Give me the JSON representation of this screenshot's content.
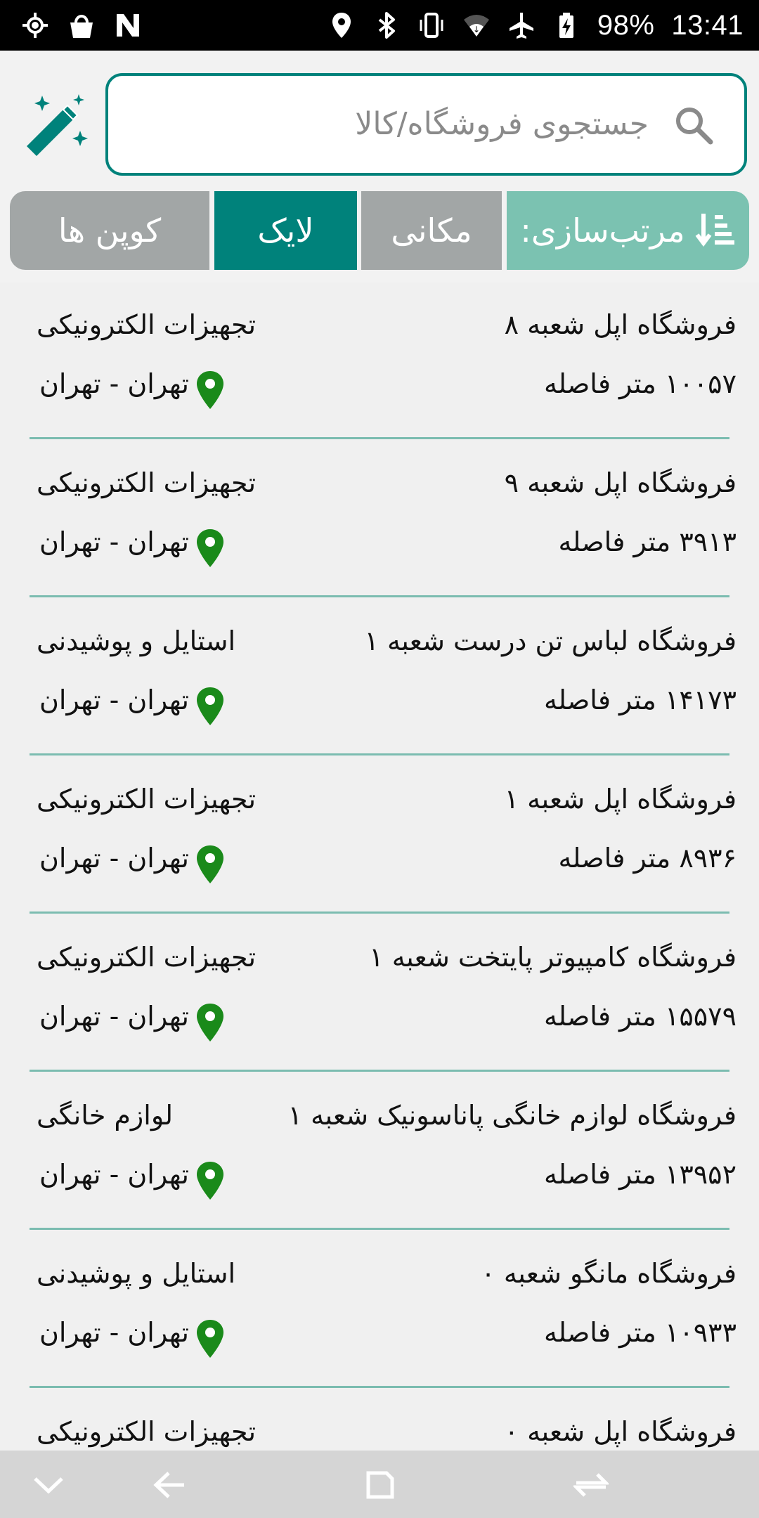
{
  "status_bar": {
    "battery": "98%",
    "time": "13:41",
    "icons": [
      "gps-icon",
      "shopping-bag-icon",
      "n-logo-icon",
      "location-icon",
      "bluetooth-icon",
      "vibrate-icon",
      "wifi-icon",
      "airplane-mode-icon",
      "battery-charging-icon"
    ]
  },
  "search": {
    "placeholder": "جستجوی فروشگاه/کالا"
  },
  "tabs": {
    "sort": "مرتب‌سازی:",
    "makani": "مکانی",
    "like": "لایک",
    "coupons": "کوپن ها",
    "active": "like"
  },
  "colors": {
    "accent": "#00827b",
    "accent_light": "#7bc2b1",
    "tab_inactive": "#a2a6a6",
    "pin": "#1a8a1a",
    "divider": "#7bbcb0"
  },
  "stores": [
    {
      "name": "فروشگاه اپل شعبه ۸",
      "category": "تجهیزات الکترونیکی",
      "distance": "۱۰۰۵۷ متر فاصله",
      "location": "تهران - تهران"
    },
    {
      "name": "فروشگاه اپل شعبه ۹",
      "category": "تجهیزات الکترونیکی",
      "distance": "۳۹۱۳ متر فاصله",
      "location": "تهران - تهران"
    },
    {
      "name": "فروشگاه لباس تن درست شعبه ۱",
      "category": "استایل و پوشیدنی",
      "distance": "۱۴۱۷۳ متر فاصله",
      "location": "تهران - تهران"
    },
    {
      "name": "فروشگاه اپل شعبه ۱",
      "category": "تجهیزات الکترونیکی",
      "distance": "۸۹۳۶ متر فاصله",
      "location": "تهران - تهران"
    },
    {
      "name": "فروشگاه کامپیوتر پایتخت شعبه ۱",
      "category": "تجهیزات الکترونیکی",
      "distance": "۱۵۵۷۹ متر فاصله",
      "location": "تهران - تهران"
    },
    {
      "name": "فروشگاه لوازم خانگی پاناسونیک شعبه ۱",
      "category": "لوازم خانگی",
      "distance": "۱۳۹۵۲ متر فاصله",
      "location": "تهران - تهران"
    },
    {
      "name": "فروشگاه مانگو شعبه ۰",
      "category": "استایل و پوشیدنی",
      "distance": "۱۰۹۳۳ متر فاصله",
      "location": "تهران - تهران"
    },
    {
      "name": "فروشگاه اپل شعبه ۰",
      "category": "تجهیزات الکترونیکی",
      "distance": "",
      "location": ""
    }
  ],
  "nav_bar": {
    "icons": [
      "chevron-down-icon",
      "back-icon",
      "home-square-icon",
      "recent-apps-icon"
    ]
  }
}
